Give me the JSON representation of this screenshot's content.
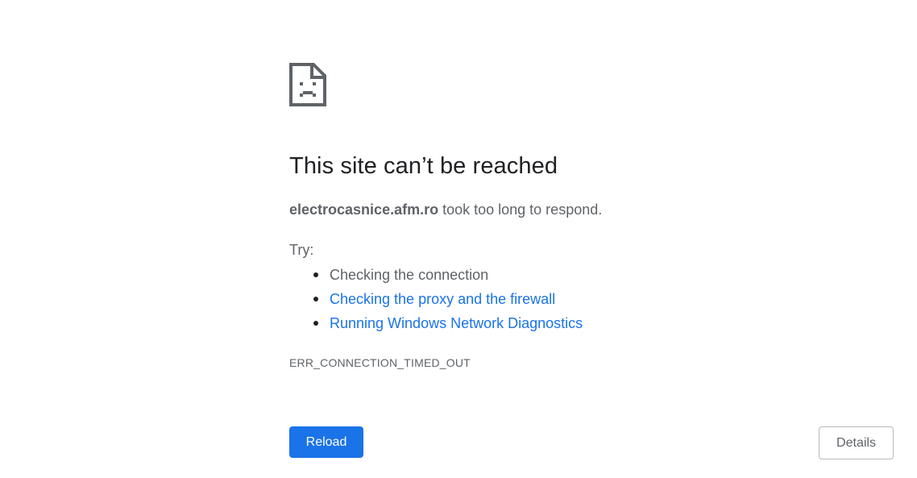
{
  "error_page": {
    "icon": "sad-document-icon",
    "title": "This site can’t be reached",
    "host": "electrocasnice.afm.ro",
    "message_suffix": " took too long to respond.",
    "try_label": "Try:",
    "suggestions": [
      {
        "label": "Checking the connection",
        "is_link": false
      },
      {
        "label": "Checking the proxy and the firewall",
        "is_link": true
      },
      {
        "label": "Running Windows Network Diagnostics",
        "is_link": true
      }
    ],
    "error_code": "ERR_CONNECTION_TIMED_OUT"
  },
  "buttons": {
    "reload_label": "Reload",
    "details_label": "Details"
  },
  "colors": {
    "link": "#1a73e8",
    "primary_button": "#1a73e8",
    "text": "#5f6368",
    "title": "#202124"
  }
}
